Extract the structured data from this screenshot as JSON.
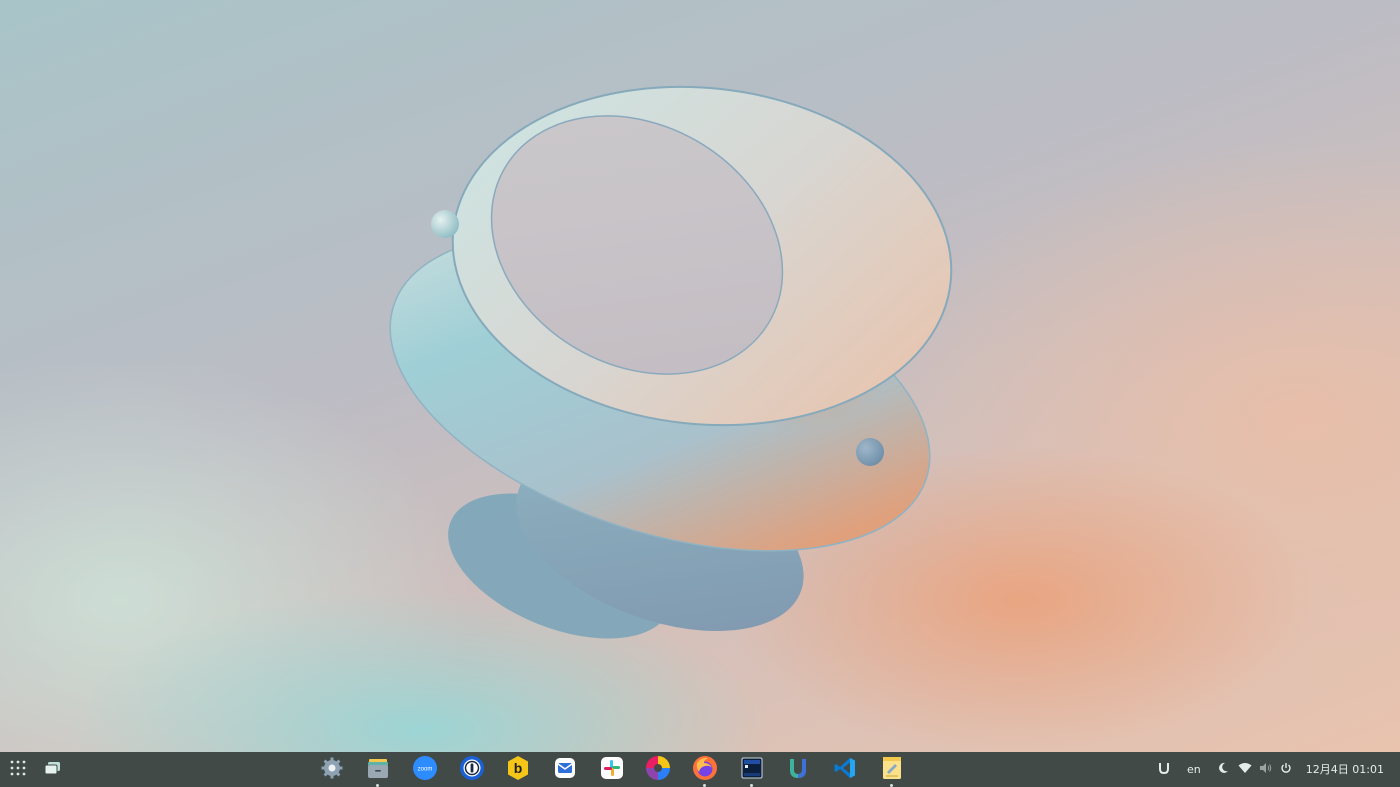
{
  "desktop": {
    "wallpaper": "abstract-floating-discs",
    "colors": {
      "teal": "#a6d9da",
      "peach": "#eaa883",
      "disc_edge": "#7fa6b6"
    }
  },
  "taskbar": {
    "background": "#414a47",
    "left": [
      {
        "icon": "app-grid-icon"
      },
      {
        "icon": "show-desktop-icon"
      }
    ],
    "apps": [
      {
        "icon": "settings-gear-icon",
        "running": false
      },
      {
        "icon": "file-manager-icon",
        "running": true
      },
      {
        "icon": "zoom-icon",
        "label": "zoom",
        "running": false
      },
      {
        "icon": "1password-icon",
        "label": "1",
        "running": false
      },
      {
        "icon": "bilibili-like-b-icon",
        "label": "b",
        "running": false
      },
      {
        "icon": "mail-icon",
        "running": false
      },
      {
        "icon": "slack-icon",
        "running": false
      },
      {
        "icon": "colorful-palette-icon",
        "running": false
      },
      {
        "icon": "firefox-icon",
        "running": true
      },
      {
        "icon": "terminal-icon",
        "running": true
      },
      {
        "icon": "u-logo-icon",
        "running": false
      },
      {
        "icon": "vscode-icon",
        "running": false
      },
      {
        "icon": "notes-icon",
        "running": true
      }
    ],
    "tray": {
      "input_method": "en",
      "icons": [
        "u-tray-icon",
        "moon-icon",
        "wifi-icon",
        "volume-icon",
        "power-icon"
      ]
    },
    "clock": "12月4日 01:01"
  }
}
